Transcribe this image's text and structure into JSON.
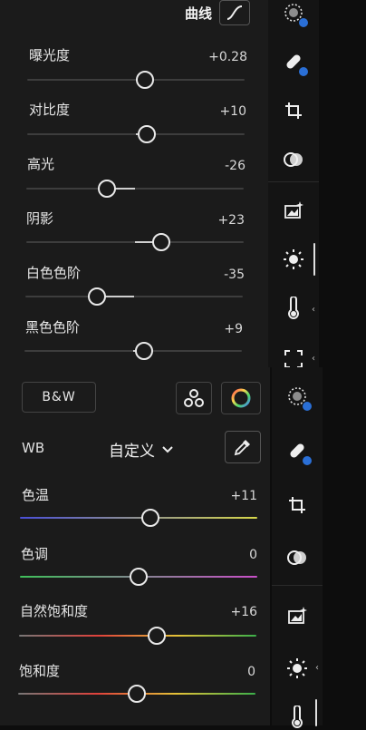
{
  "top_panel": {
    "curve_label": "曲线",
    "sliders": [
      {
        "label": "曝光度",
        "value": "+0.28",
        "level": 0.54
      },
      {
        "label": "对比度",
        "value": "+10",
        "level": 0.55
      },
      {
        "label": "高光",
        "value": "-26",
        "level": 0.37
      },
      {
        "label": "阴影",
        "value": "+23",
        "level": 0.62
      },
      {
        "label": "白色色阶",
        "value": "-35",
        "level": 0.33
      },
      {
        "label": "黑色色阶",
        "value": "+9",
        "level": 0.55
      }
    ]
  },
  "bottom_panel": {
    "bw_label": "B&W",
    "wb_label": "WB",
    "wb_value": "自定义",
    "sliders": [
      {
        "label": "色温",
        "value": "+11",
        "level": 0.55,
        "gradient": [
          "#4a4fd8",
          "#d8d84a"
        ]
      },
      {
        "label": "色调",
        "value": "0",
        "level": 0.5,
        "gradient": [
          "#3fbf5a",
          "#c94fc9"
        ]
      },
      {
        "label": "自然饱和度",
        "value": "+16",
        "level": 0.58,
        "gradient": [
          "#777777",
          "#e0413b",
          "#e5c238",
          "#3bb04a"
        ]
      },
      {
        "label": "饱和度",
        "value": "0",
        "level": 0.5,
        "gradient": [
          "#777777",
          "#e0413b",
          "#e5c238",
          "#3bb04a"
        ]
      }
    ]
  },
  "rail_icons_top": [
    "mask-icon",
    "heal-icon",
    "crop-icon",
    "presets-icon",
    "enhance-image-icon",
    "light-icon",
    "color-temperature-icon",
    "vignette-icon"
  ],
  "rail_icons_bottom": [
    "mask-icon",
    "heal-icon",
    "crop-icon",
    "presets-icon",
    "enhance-image-icon",
    "light-icon",
    "color-temperature-icon"
  ]
}
